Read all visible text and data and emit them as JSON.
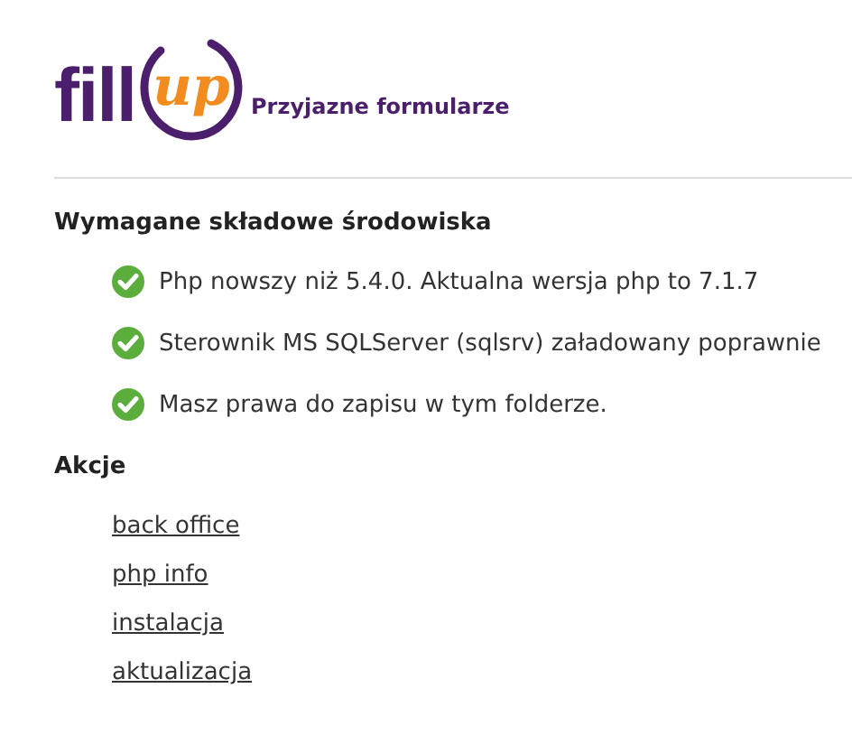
{
  "logo": {
    "word": "fill",
    "accent": "up",
    "tagline": "Przyjazne formularze"
  },
  "requirements": {
    "title": "Wymagane składowe środowiska",
    "items": [
      {
        "text": "Php nowszy niż 5.4.0. Aktualna wersja php to 7.1.7",
        "passed": true
      },
      {
        "text": "Sterownik MS SQLServer (sqlsrv) załadowany poprawnie",
        "passed": true
      },
      {
        "text": "Masz prawa do zapisu w tym folderze.",
        "passed": true
      }
    ]
  },
  "actions": {
    "title": "Akcje",
    "links": [
      "back office",
      "php info",
      "instalacja",
      "aktualizacja"
    ]
  }
}
